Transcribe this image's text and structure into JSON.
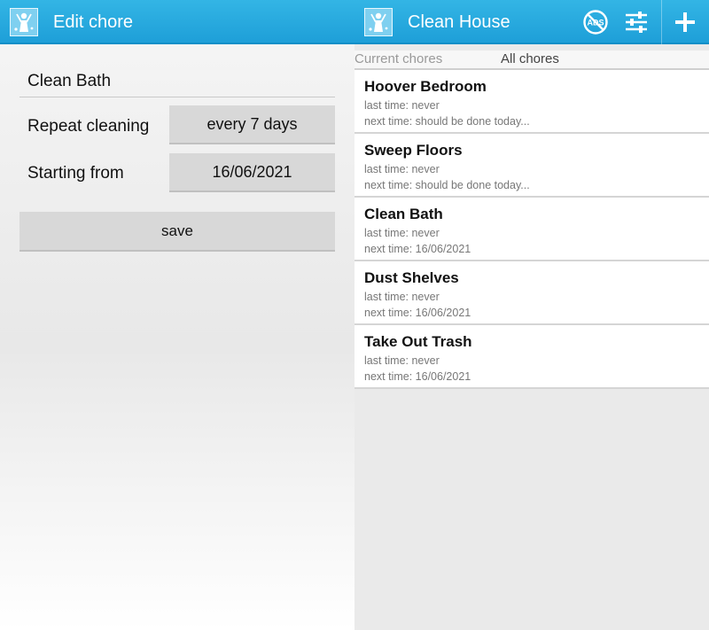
{
  "edit_screen": {
    "title": "Edit chore",
    "chore_name": "Clean Bath",
    "repeat_label": "Repeat cleaning",
    "repeat_value": "every 7 days",
    "start_label": "Starting from",
    "start_value": "16/06/2021",
    "save_label": "save"
  },
  "list_screen": {
    "title": "Clean House",
    "icons": {
      "no_ads": "no-ads-icon",
      "settings": "sliders-icon",
      "add": "plus-icon"
    },
    "tabs": [
      "Current chores",
      "All chores"
    ],
    "chores": [
      {
        "name": "Hoover Bedroom",
        "last": "last time: never",
        "next": "next time: should be done today..."
      },
      {
        "name": "Sweep Floors",
        "last": "last time: never",
        "next": "next time: should be done today..."
      },
      {
        "name": "Clean Bath",
        "last": "last time: never",
        "next": "next time: 16/06/2021"
      },
      {
        "name": "Dust Shelves",
        "last": "last time: never",
        "next": "next time: 16/06/2021"
      },
      {
        "name": "Take Out Trash",
        "last": "last time: never",
        "next": "next time: 16/06/2021"
      }
    ]
  },
  "colors": {
    "action_bar": "#33b5e5",
    "button_gray": "#d8d8d8"
  }
}
